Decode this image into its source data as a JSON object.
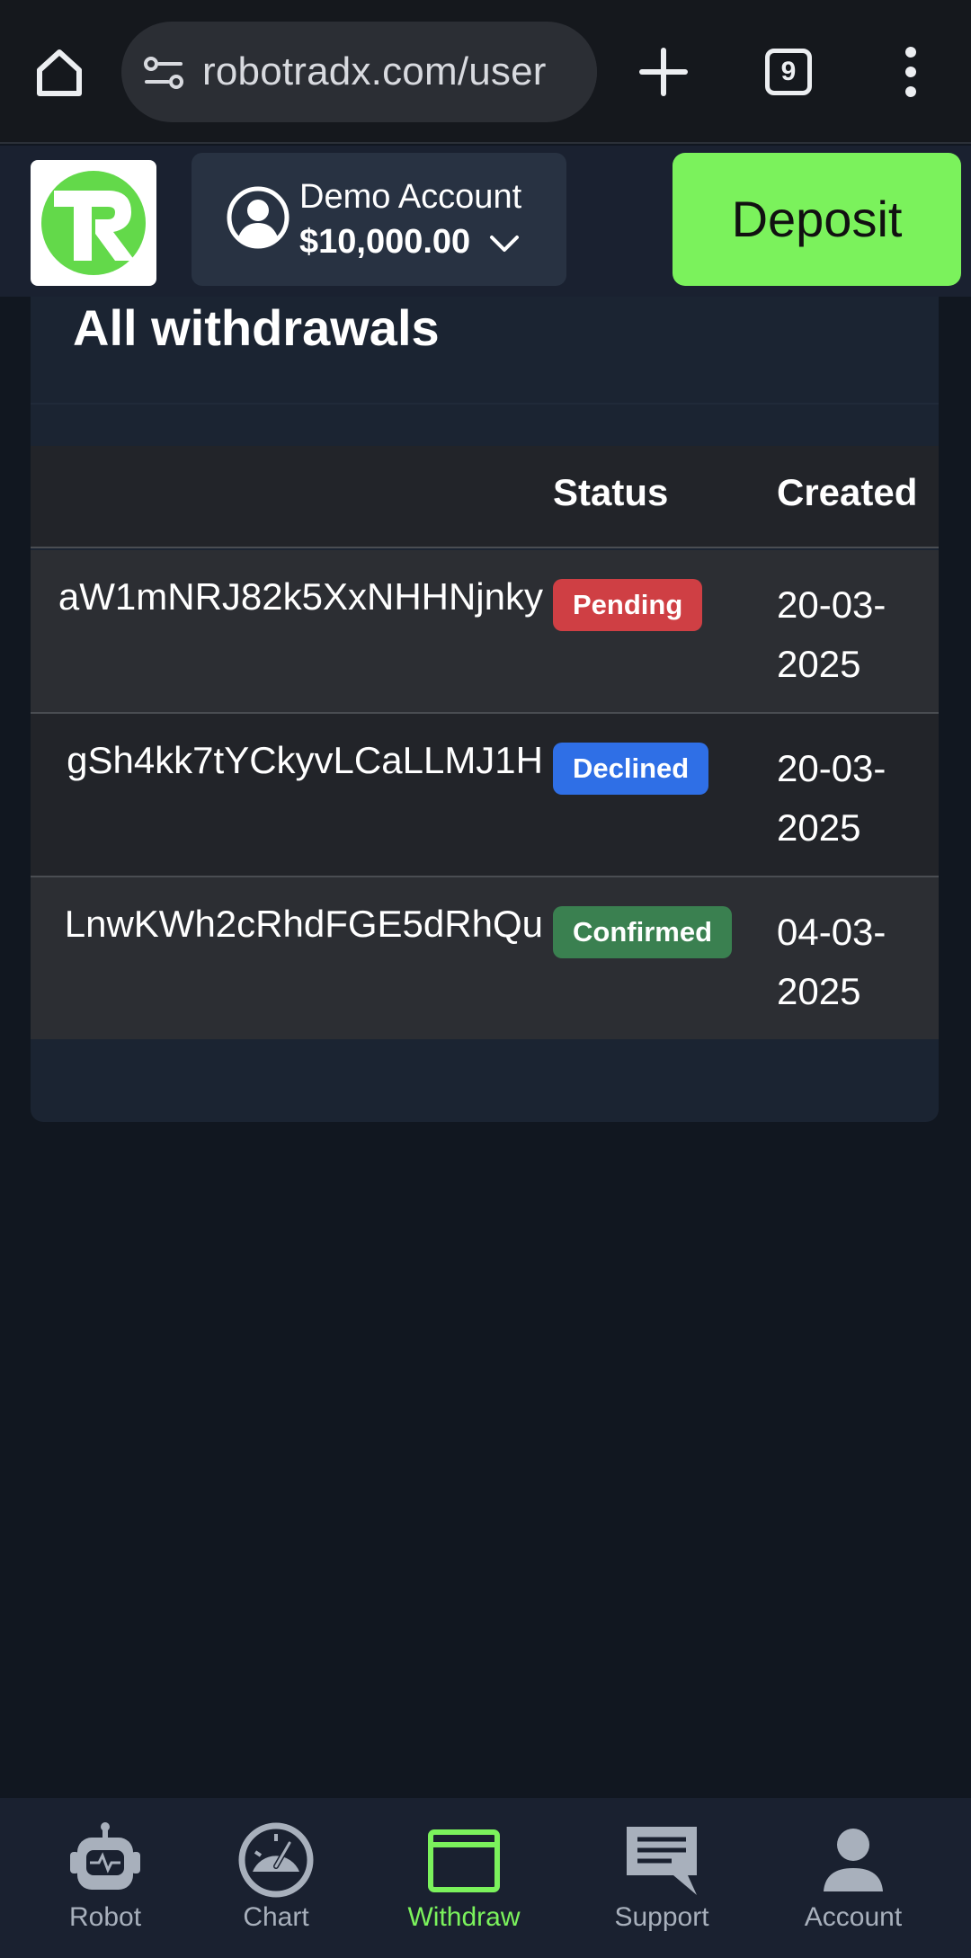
{
  "browser": {
    "url": "robotradx.com/user",
    "tab_count": "9"
  },
  "header": {
    "account_name": "Demo Account",
    "account_balance": "$10,000.00",
    "deposit_label": "Deposit"
  },
  "withdrawals": {
    "title": "All withdrawals",
    "columns": {
      "status": "Status",
      "created": "Created"
    },
    "rows": [
      {
        "address": "aW1mNRJ82k5XxNHHNjnky",
        "status": "Pending",
        "created": "20-03-2025",
        "status_color": "#cf3f44"
      },
      {
        "address": "gSh4kk7tYCkyvLCaLLMJ1H",
        "status": "Declined",
        "created": "20-03-2025",
        "status_color": "#2f6fe6"
      },
      {
        "address": "LnwKWh2cRhdFGE5dRhQu",
        "status": "Confirmed",
        "created": "04-03-2025",
        "status_color": "#3a8050"
      }
    ]
  },
  "nav": {
    "robot": "Robot",
    "chart": "Chart",
    "withdraw": "Withdraw",
    "support": "Support",
    "account": "Account",
    "active": "withdraw"
  },
  "colors": {
    "accent": "#7bf25c",
    "background": "#111720",
    "header": "#1a2130"
  }
}
